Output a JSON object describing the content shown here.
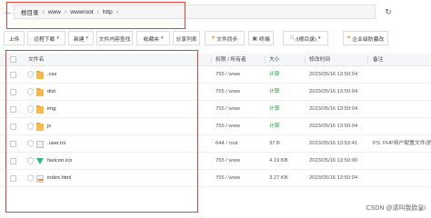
{
  "address": {
    "crumbs": [
      "根目录",
      "www",
      "wwwroot",
      "http"
    ]
  },
  "toolbar": {
    "upload": "上传",
    "remote_download": "远程下载",
    "new": "新建",
    "content_search": "文件内容查找",
    "favorites": "收藏夹",
    "share_list": "分享列表",
    "file_sync": "文件同步",
    "terminal": "终端",
    "root_dir_btn": "/(根目录)",
    "enterprise_tamper": "企业级防篡改"
  },
  "table": {
    "headers": {
      "name": "文件名",
      "perm": "权限 / 所有者",
      "size": "大小",
      "mtime": "修改时间",
      "note": "备注"
    },
    "rows": [
      {
        "name": ".css",
        "type": "folder",
        "perm": "755 / www",
        "size": "计算",
        "mtime": "2023/05/16 13:50:04",
        "note": ""
      },
      {
        "name": "dist",
        "type": "folder",
        "perm": "755 / www",
        "size": "计算",
        "mtime": "2023/05/16 13:50:04",
        "note": ""
      },
      {
        "name": "img",
        "type": "folder",
        "perm": "755 / www",
        "size": "计算",
        "mtime": "2023/05/16 13:50:04",
        "note": ""
      },
      {
        "name": "js",
        "type": "folder",
        "perm": "755 / www",
        "size": "计算",
        "mtime": "2023/05/16 13:50:04",
        "note": ""
      },
      {
        "name": ".user.ini",
        "type": "file",
        "perm": "644 / root",
        "size": "37 B",
        "mtime": "2023/05/16 13:53:41",
        "note": "PS: PHP用户配置文件(防"
      },
      {
        "name": "favicon.ico",
        "type": "vue",
        "perm": "755 / www",
        "size": "4.19 KB",
        "mtime": "2023/05/16 13:50:00",
        "note": ""
      },
      {
        "name": "index.html",
        "type": "html",
        "perm": "755 / www",
        "size": "3.27 KB",
        "mtime": "2023/05/16 13:50:04",
        "note": ""
      }
    ]
  },
  "watermark": "CSDN @请叫我欧皇i",
  "colors": {
    "highlight_red": "#e5403c",
    "folder_yellow": "#f7b94b",
    "calc_green": "#20a53a",
    "vue_green": "#2fbb7c"
  }
}
